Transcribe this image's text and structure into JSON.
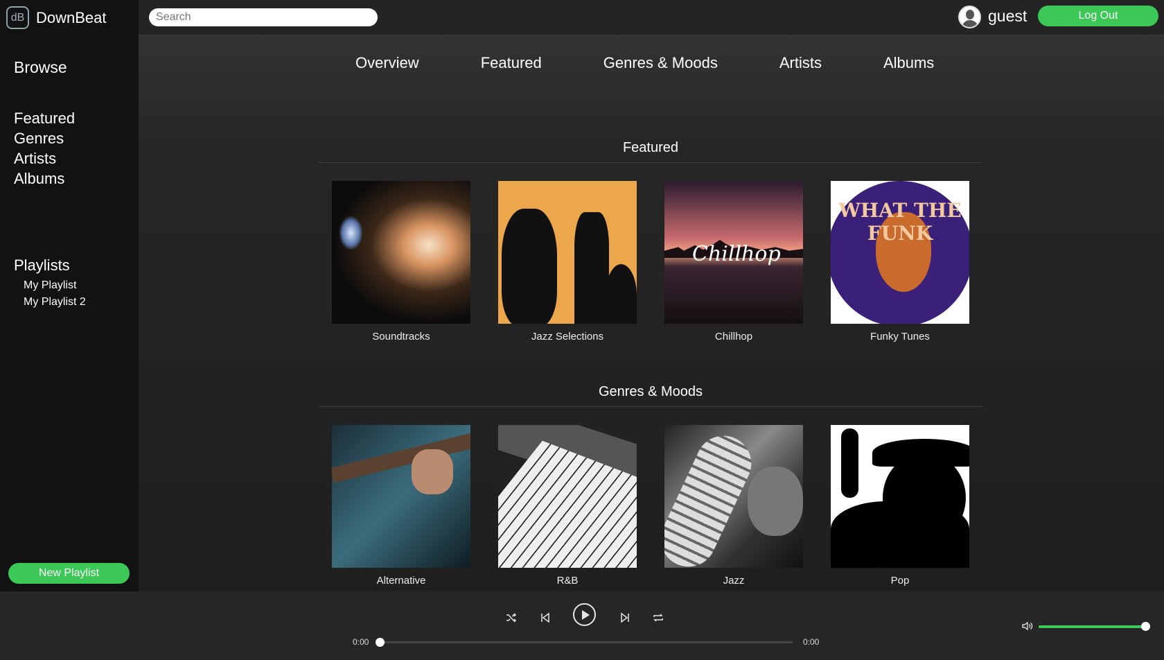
{
  "app": {
    "brand_badge": "dB",
    "brand_name": "DownBeat"
  },
  "sidebar": {
    "heading": "Browse",
    "nav": [
      {
        "label": "Featured"
      },
      {
        "label": "Genres"
      },
      {
        "label": "Artists"
      },
      {
        "label": "Albums"
      }
    ],
    "playlists_heading": "Playlists",
    "playlists": [
      {
        "label": "My Playlist"
      },
      {
        "label": "My Playlist 2"
      }
    ],
    "new_playlist_label": "New Playlist"
  },
  "header": {
    "search_placeholder": "Search",
    "user_name": "guest",
    "logout_label": "Log Out"
  },
  "tabs": [
    {
      "label": "Overview"
    },
    {
      "label": "Featured"
    },
    {
      "label": "Genres & Moods"
    },
    {
      "label": "Artists"
    },
    {
      "label": "Albums"
    }
  ],
  "featured": {
    "title": "Featured",
    "items": [
      {
        "label": "Soundtracks"
      },
      {
        "label": "Jazz Selections"
      },
      {
        "label": "Chillhop"
      },
      {
        "label": "Funky Tunes"
      }
    ]
  },
  "genres": {
    "title": "Genres & Moods",
    "items": [
      {
        "label": "Alternative"
      },
      {
        "label": "R&B"
      },
      {
        "label": "Jazz"
      },
      {
        "label": "Pop"
      }
    ]
  },
  "artwork_text": {
    "chillhop": "Chillhop",
    "funk": "WHAT THE FUNK"
  },
  "player": {
    "current_time": "0:00",
    "duration": "0:00",
    "progress": 0,
    "volume": 1.0,
    "icons": [
      "shuffle-icon",
      "previous-icon",
      "play-icon",
      "next-icon",
      "repeat-icon",
      "volume-icon"
    ]
  },
  "colors": {
    "accent": "#3cc857",
    "sidebar_bg": "#121212",
    "main_bg": "#1f1f1f"
  }
}
